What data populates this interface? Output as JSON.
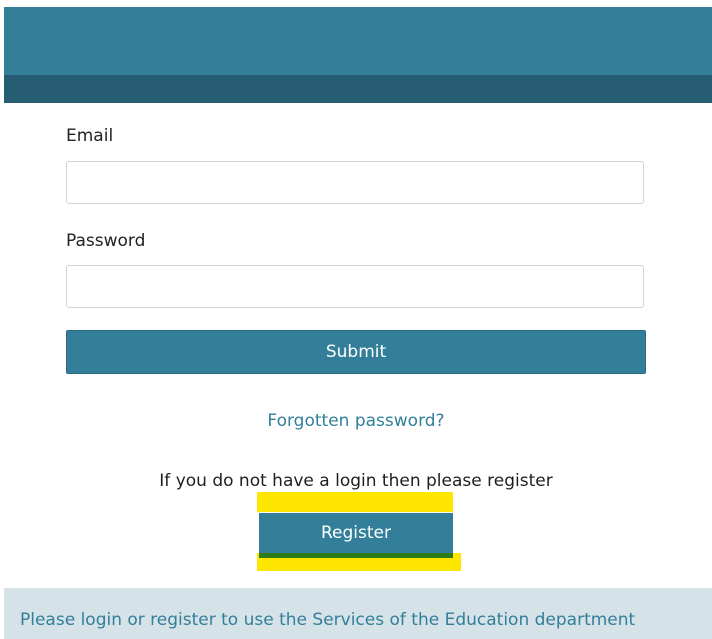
{
  "form": {
    "email_label": "Email",
    "email_value": "",
    "password_label": "Password",
    "password_value": "",
    "submit_label": "Submit"
  },
  "links": {
    "forgot_password": "Forgotten password?"
  },
  "register": {
    "hint": "If you do not have a login then please register",
    "button_label": "Register"
  },
  "footer": {
    "text": "Please login or register to use the Services of the Education department"
  },
  "colors": {
    "primary": "#337f9a",
    "primary_dark": "#275d72",
    "footer_bg": "#d5e2e8",
    "highlight": "#ffe600",
    "register_underline": "#2f7b19"
  }
}
